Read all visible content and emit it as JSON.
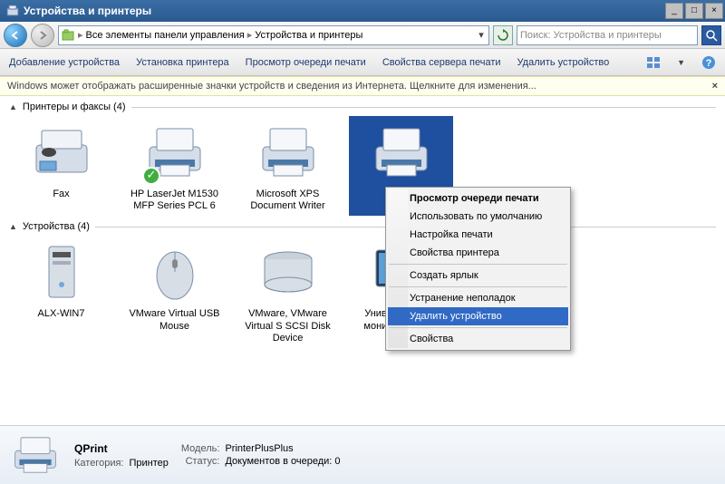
{
  "window": {
    "title": "Устройства и принтеры"
  },
  "address": {
    "seg1": "Все элементы панели управления",
    "seg2": "Устройства и принтеры"
  },
  "search": {
    "placeholder": "Поиск: Устройства и принтеры"
  },
  "toolbar": {
    "add_device": "Добавление устройства",
    "add_printer": "Установка принтера",
    "view_queue": "Просмотр очереди печати",
    "server_props": "Свойства сервера печати",
    "remove_device": "Удалить устройство"
  },
  "infobar": {
    "text": "Windows может отображать расширенные значки устройств и сведения из Интернета.  Щелкните для изменения..."
  },
  "groups": {
    "printers": {
      "title": "Принтеры и факсы (4)"
    },
    "devices": {
      "title": "Устройства (4)"
    }
  },
  "printers": [
    {
      "name": "Fax"
    },
    {
      "name": "HP LaserJet M1530 MFP Series PCL 6"
    },
    {
      "name": "Microsoft XPS Document Writer"
    },
    {
      "name": "QPrint"
    }
  ],
  "devices": [
    {
      "name": "ALX-WIN7"
    },
    {
      "name": "VMware Virtual USB Mouse"
    },
    {
      "name": "VMware, VMware Virtual S SCSI Disk Device"
    },
    {
      "name": "Универсальный монитор не PnP"
    }
  ],
  "context_menu": {
    "view_queue": "Просмотр очереди печати",
    "set_default": "Использовать по умолчанию",
    "printing_prefs": "Настройка печати",
    "printer_props": "Свойства принтера",
    "create_shortcut": "Создать ярлык",
    "troubleshoot": "Устранение неполадок",
    "remove_device": "Удалить устройство",
    "properties": "Свойства"
  },
  "details": {
    "name": "QPrint",
    "model_label": "Модель:",
    "model": "PrinterPlusPlus",
    "category_label": "Категория:",
    "category": "Принтер",
    "status_label": "Статус:",
    "status": "Документов в очереди: 0"
  }
}
